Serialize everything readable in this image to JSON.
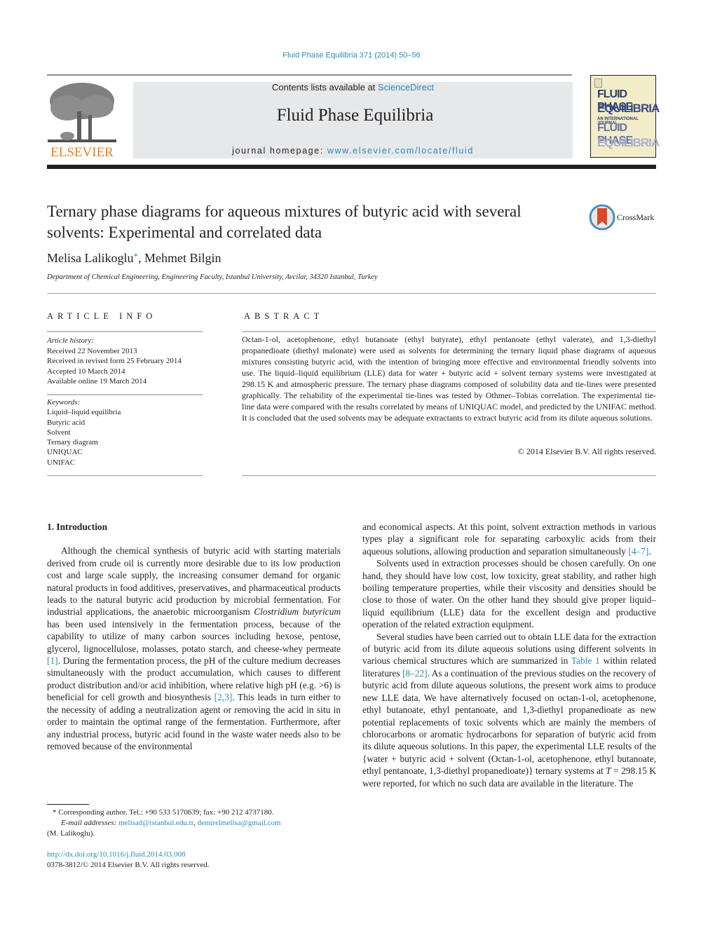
{
  "header": {
    "journal_ref": "Fluid Phase Equilibria 371 (2014) 50–56",
    "contents_prefix": "Contents lists available at ",
    "contents_link": "ScienceDirect",
    "journal_title": "Fluid Phase Equilibria",
    "homepage_prefix": "journal homepage: ",
    "homepage_link": "www.elsevier.com/locate/fluid",
    "publisher_logo_text": "ELSEVIER",
    "cover_lines": [
      "FLUID PHASE",
      "EQUILIBRIA",
      "AN INTERNATIONAL JOURNAL",
      "FLUID PHASE",
      "EQUILIBRIA"
    ],
    "colors": {
      "link": "#2a8bb5",
      "elsevier_orange": "#f07f20",
      "banner_bg": "#e7e8e9",
      "cover_bg": "#f3ecc9"
    }
  },
  "article": {
    "title": "Ternary phase diagrams for aqueous mixtures of butyric acid with several solvents: Experimental and correlated data",
    "crossmark_label": "CrossMark",
    "author1": "Melisa Lalikoglu",
    "author1_mark": "*",
    "author_sep": ", ",
    "author2": "Mehmet Bilgin",
    "affiliation": "Department of Chemical Engineering, Engineering Faculty, Istanbul University, Avcilar, 34320 Istanbul, Turkey"
  },
  "article_info": {
    "heading": "ARTICLE INFO",
    "history_label": "Article history:",
    "history": [
      "Received 22 November 2013",
      "Received in revised form 25 February 2014",
      "Accepted 10 March 2014",
      "Available online 19 March 2014"
    ],
    "keywords_label": "Keywords:",
    "keywords": [
      "Liquid–liquid equilibria",
      "Butyric acid",
      "Solvent",
      "Ternary diagram",
      "UNIQUAC",
      "UNIFAC"
    ]
  },
  "abstract": {
    "heading": "ABSTRACT",
    "text": "Octan-1-ol, acetophenone, ethyl butanoate (ethyl butyrate), ethyl pentanoate (ethyl valerate), and 1,3-diethyl propanedioate (diethyl malonate) were used as solvents for determining the ternary liquid phase diagrams of aqueous mixtures consisting butyric acid, with the intention of bringing more effective and environmental friendly solvents into use. The liquid–liquid equilibrium (LLE) data for water + butyric acid + solvent ternary systems were investigated at 298.15 K and atmospheric pressure. The ternary phase diagrams composed of solubility data and tie-lines were presented graphically. The reliability of the experimental tie-lines was tested by Othmer–Tobias correlation. The experimental tie-line data were compared with the results correlated by means of UNIQUAC model, and predicted by the UNIFAC method. It is concluded that the used solvents may be adequate extractants to extract butyric acid from its dilute aqueous solutions.",
    "copyright": "© 2014 Elsevier B.V. All rights reserved."
  },
  "body": {
    "section_heading": "1.  Introduction",
    "left_p1_a": "Although the chemical synthesis of butyric acid with starting materials derived from crude oil is currently more desirable due to its low production cost and large scale supply, the increasing consumer demand for organic natural products in food additives, preservatives, and pharmaceutical products leads to the natural butyric acid production by microbial fermentation. For industrial applications, the anaerobic microorganism ",
    "left_p1_italic": "Clostridium butyricum",
    "left_p1_b": " has been used intensively in the fermentation process, because of the capability to utilize of many carbon sources including hexose, pentose, glycerol, lignocellulose, molasses, potato starch, and cheese-whey permeate ",
    "ref1": "[1]",
    "left_p1_c": ". During the fermentation process, the pH of the culture medium decreases simultaneously with the product accumulation, which causes to different product distribution and/or acid inhibition, where relative high pH (e.g. >6) is beneficial for cell growth and biosynthesis ",
    "ref2": "[2,3]",
    "left_p1_d": ". This leads in turn either to the necessity of adding a neutralization agent or removing the acid in situ in order to maintain the optimal range of the fermentation. Furthermore, after any industrial process, butyric acid found in the waste water needs also to be removed because of the environmental",
    "right_p0_a": "and economical aspects. At this point, solvent extraction methods in various types play a significant role for separating carboxylic acids from their aqueous solutions, allowing production and separation simultaneously ",
    "ref3": "[4–7]",
    "right_p0_b": ".",
    "right_p1": "Solvents used in extraction processes should be chosen carefully. On one hand, they should have low cost, low toxicity, great stability, and rather high boiling temperature properties, while their viscosity and densities should be close to those of water. On the other hand they should give proper liquid–liquid equilibrium (LLE) data for the excellent design and productive operation of the related extraction equipment.",
    "right_p2_a": "Several studies have been carried out to obtain LLE data for the extraction of butyric acid from its dilute aqueous solutions using different solvents in various chemical structures which are summarized in ",
    "table_ref": "Table 1",
    "right_p2_b": " within related literatures ",
    "ref4": "[8–22]",
    "right_p2_c": ". As a continuation of the previous studies on the recovery of butyric acid from dilute aqueous solutions, the present work aims to produce new LLE data. We have alternatively focused on octan-1-ol, acetophenone, ethyl butanoate, ethyl pentanoate, and 1,3-diethyl propanedioate as new potential replacements of toxic solvents which are mainly the members of chlorocarbons or aromatic hydrocarbons for separation of butyric acid from its dilute aqueous solutions. In this paper, the experimental LLE results of the {water + butyric acid + solvent (Octan-1-ol, acetophenone, ethyl butanoate, ethyl pentanoate, 1,3-diethyl propanedioate)} ternary systems at ",
    "right_p2_T": "T",
    "right_p2_d": " = 298.15 K were reported, for which no such data are available in the literature. The"
  },
  "footnotes": {
    "corresponding": "*  Corresponding author. Tel.: +90 533 5170639; fax: +90 212 4737180.",
    "email_label": "E-mail addresses:",
    "email1": "melisad@istanbul.edu.tr",
    "email_sep": ", ",
    "email2": "demirelmelisa@gmail.com",
    "email_owner": "(M. Lalikoglu).",
    "doi": "http://dx.doi.org/10.1016/j.fluid.2014.03.008",
    "issn_copyright": "0378-3812/© 2014 Elsevier B.V. All rights reserved."
  }
}
